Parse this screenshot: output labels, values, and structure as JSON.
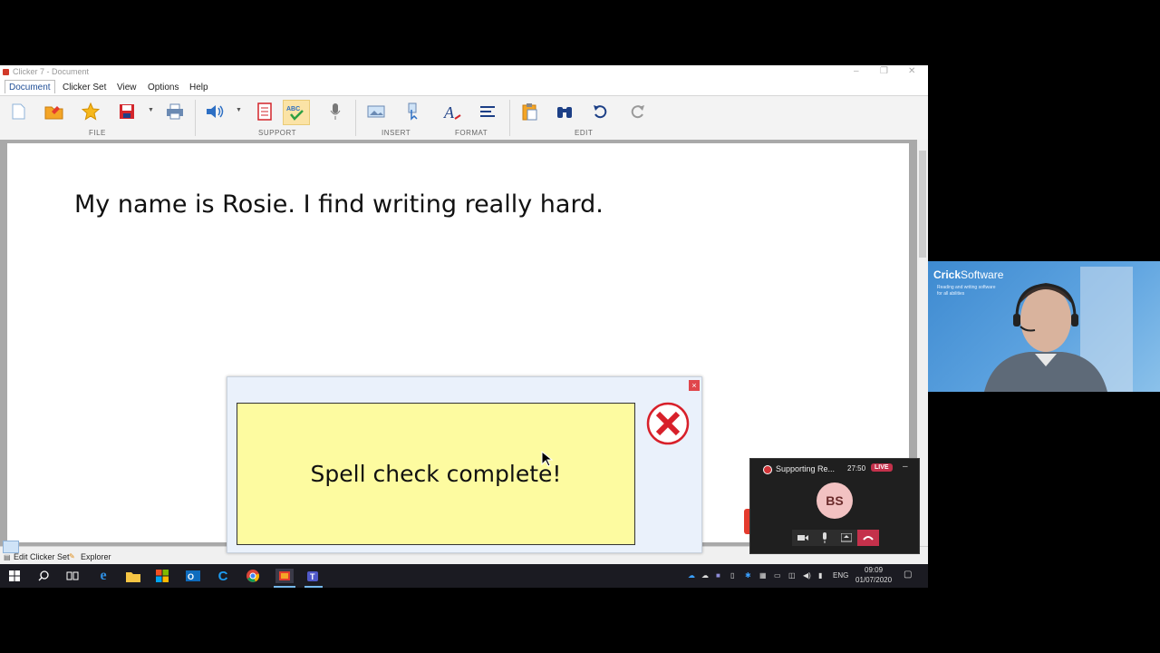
{
  "window": {
    "title": "Clicker 7 - Document",
    "controls": [
      "–",
      "❐",
      "✕"
    ]
  },
  "menu": [
    "Document",
    "Clicker Set",
    "View",
    "Options",
    "Help"
  ],
  "ribbon": {
    "groups": [
      "FILE",
      "SUPPORT",
      "INSERT",
      "FORMAT",
      "EDIT"
    ]
  },
  "document": {
    "text": "My name is Rosie. I find writing really hard."
  },
  "dialog": {
    "message": "Spell check complete!",
    "close": "×"
  },
  "statusbar": {
    "edit_label": "Edit Clicker Set",
    "explorer_label": "Explorer"
  },
  "taskbar": {
    "lang": "ENG",
    "time": "09:09",
    "date": "01/07/2020"
  },
  "video": {
    "brand_bold": "Crick",
    "brand_light": "Software",
    "tagline1": "Reading and writing software",
    "tagline2": "for all abilities"
  },
  "teams": {
    "meeting_name": "Supporting Re...",
    "duration": "27:50",
    "live": "LIVE",
    "initials": "BS",
    "minimize": "–"
  },
  "colors": {
    "spellbox_bg": "#fdfba0",
    "dialog_bg": "#eaf1fb",
    "live_red": "#c4314b",
    "selected_button": "#fbe3a6"
  }
}
